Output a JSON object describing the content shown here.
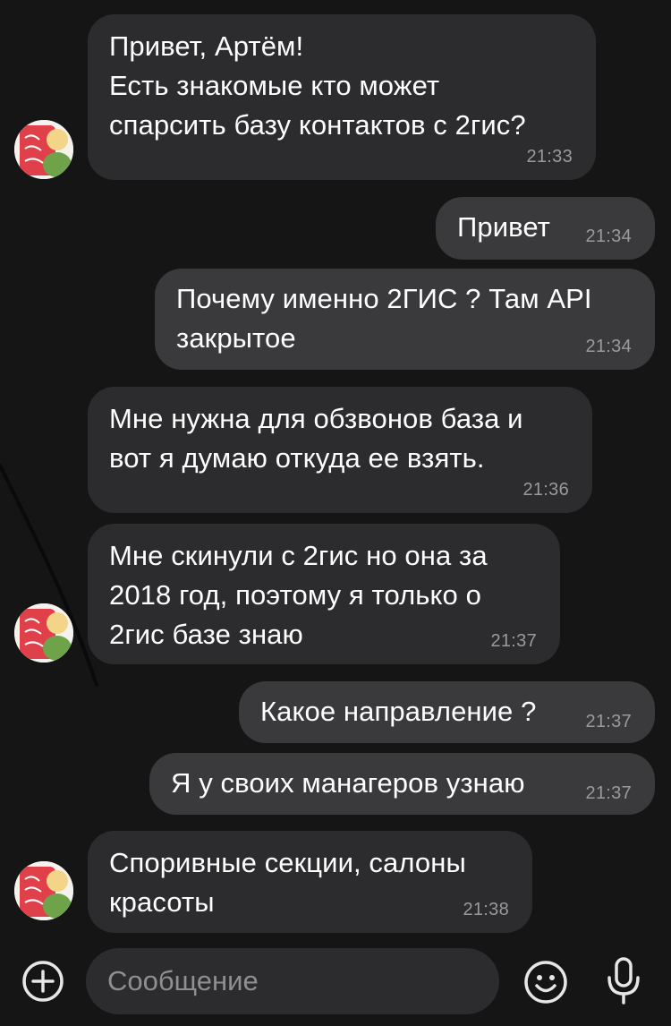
{
  "chat": {
    "messages": [
      {
        "direction": "in",
        "text": "Привет, Артём!\nЕсть знакомые кто может\nспарсить базу контактов с 2гис?",
        "time": "21:33"
      },
      {
        "direction": "out",
        "text": "Привет",
        "time": "21:34"
      },
      {
        "direction": "out",
        "text": "Почему именно 2ГИС ? Там API\nзакрытое",
        "time": "21:34"
      },
      {
        "direction": "in",
        "text": "Мне нужна для обзвонов база и\nвот я думаю откуда ее взять.",
        "time": "21:36"
      },
      {
        "direction": "in",
        "text": "Мне скинули с 2гис но она за\n2018 год, поэтому я только о\n2гис базе знаю",
        "time": "21:37"
      },
      {
        "direction": "out",
        "text": "Какое направление ?",
        "time": "21:37"
      },
      {
        "direction": "out",
        "text": "Я у своих манагеров узнаю",
        "time": "21:37"
      },
      {
        "direction": "in",
        "text": "Споривные секции, салоны\nкрасоты",
        "time": "21:38"
      }
    ]
  },
  "composer": {
    "placeholder": "Сообщение",
    "icons": {
      "left": "add-attachment-icon",
      "emoji": "emoji-icon",
      "voice": "microphone-icon"
    }
  },
  "colors": {
    "background": "#151515",
    "incoming_bubble": "#2c2c2e",
    "outgoing_bubble": "#3a3a3c",
    "time_text": "#9a9a9e",
    "placeholder_text": "#8e8e93"
  }
}
